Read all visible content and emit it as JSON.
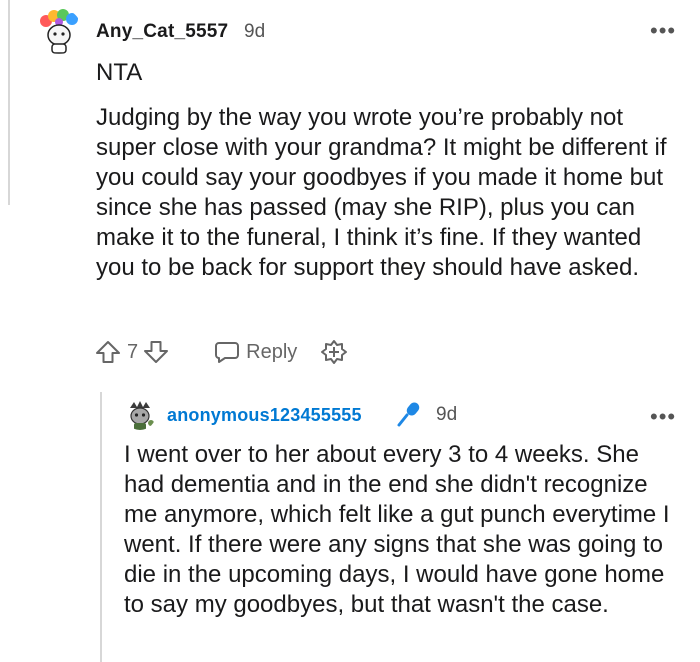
{
  "comment": {
    "username": "Any_Cat_5557",
    "age": "9d",
    "verdict": "NTA",
    "body": "Judging by the way you wrote you’re probably not super close with your grandma? It might be different if you could say your goodbyes if you made it home but since she has passed (may she RIP), plus you can make it to the funeral, I think it’s fine. If they wanted you to be back for support they should have asked.",
    "vote_count": "7",
    "reply_label": "Reply",
    "more_label": "•••"
  },
  "reply": {
    "username": "anonymous123455555",
    "age": "9d",
    "body": "I went over to her about every 3 to 4 weeks. She had dementia and in the end she didn't recognize me anymore, which felt like a gut punch everytime I went. If there were any signs that she was going to die in the upcoming days, I would have gone home to say my goodbyes, but that wasn't the case.",
    "more_label": "•••"
  },
  "colors": {
    "op_blue": "#0079d3",
    "mic_blue": "#1e88e5"
  }
}
